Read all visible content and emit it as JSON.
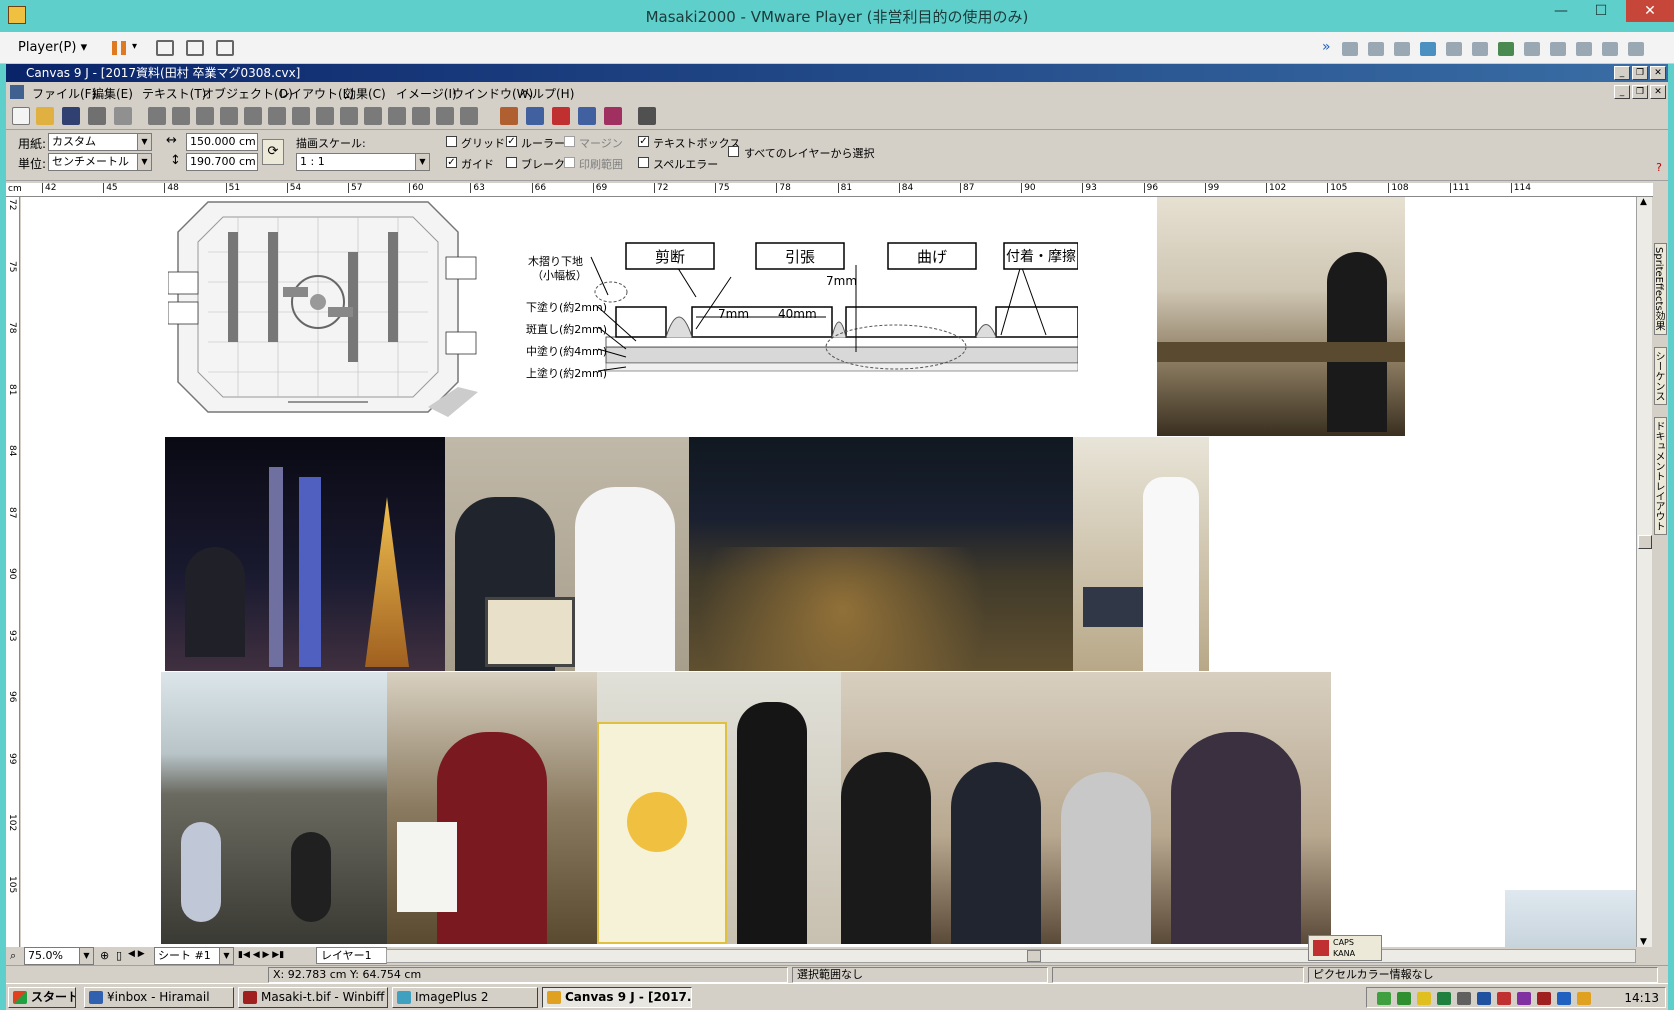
{
  "vmware": {
    "title": "Masaki2000 - VMware Player (非営利目的の使用のみ)",
    "player_menu": "Player(P)",
    "minimize": "—",
    "maximize": "☐",
    "close": "✕"
  },
  "app": {
    "title": "Canvas 9 J - [2017資料(田村 卒業マグ0308.cvx]",
    "menus": [
      "ファイル(F)",
      "編集(E)",
      "テキスト(T)",
      "オブジェクト(O)",
      "レイアウト(L)",
      "効果(C)",
      "イメージ(I)",
      "ウインドウ(W)",
      "ヘルプ(H)"
    ]
  },
  "properties": {
    "paper_label": "用紙:",
    "paper_value": "カスタム",
    "unit_label": "単位:",
    "unit_value": "センチメートル",
    "width_value": "150.000 cm",
    "height_value": "190.700 cm",
    "scale_label": "描画スケール:",
    "scale_value": "1 : 1",
    "grid": "グリッド",
    "guide": "ガイド",
    "ruler": "ルーラー",
    "break": "ブレーク",
    "margin": "マージン",
    "print_area": "印刷範囲",
    "textbox": "テキストボックス",
    "spell_error": "スペルエラー",
    "select_all_layers": "すべてのレイヤーから選択",
    "help_mark": "?"
  },
  "checks": {
    "grid": false,
    "guide": true,
    "ruler": true,
    "break": false,
    "margin": false,
    "print_area": false,
    "textbox": true,
    "spell_error": false,
    "select_all_layers": false
  },
  "ruler": {
    "unit": "cm",
    "h_ticks": [
      "42",
      "45",
      "48",
      "51",
      "54",
      "57",
      "60",
      "63",
      "66",
      "69",
      "72",
      "75",
      "78",
      "81",
      "84",
      "87",
      "90",
      "93",
      "96",
      "99",
      "102",
      "105",
      "108",
      "111",
      "114"
    ],
    "v_ticks": [
      "72",
      "75",
      "78",
      "81",
      "84",
      "87",
      "90",
      "93",
      "96",
      "99",
      "102",
      "105"
    ]
  },
  "diagram": {
    "labels_left": [
      "木摺り下地",
      "（小幅板）",
      "下塗り(約2mm)",
      "斑直し(約2mm)",
      "中塗り(約4mm)",
      "上塗り(約2mm)"
    ],
    "boxes": [
      "剪断",
      "引張",
      "曲げ",
      "付着・摩擦"
    ],
    "dims": [
      "7mm",
      "7mm",
      "40mm"
    ]
  },
  "side_tabs": [
    "SpriteEffects効果",
    "シーケンス",
    "ドキュメントレイアウト"
  ],
  "bottom": {
    "zoom": "75.0%",
    "sheet": "シート #1",
    "layer": "レイヤー1",
    "caps": "CAPS",
    "kana": "KANA"
  },
  "status": {
    "coords": "X: 92.783 cm Y: 64.754 cm",
    "selection": "選択範囲なし",
    "pixel_info": "ピクセルカラー情報なし"
  },
  "taskbar": {
    "start": "スタート",
    "tasks": [
      "¥inbox - Hiramail",
      "Masaki-t.bif - Winbiff",
      "ImagePlus 2",
      "Canvas 9 J - [2017..."
    ],
    "clock": "14:13"
  }
}
